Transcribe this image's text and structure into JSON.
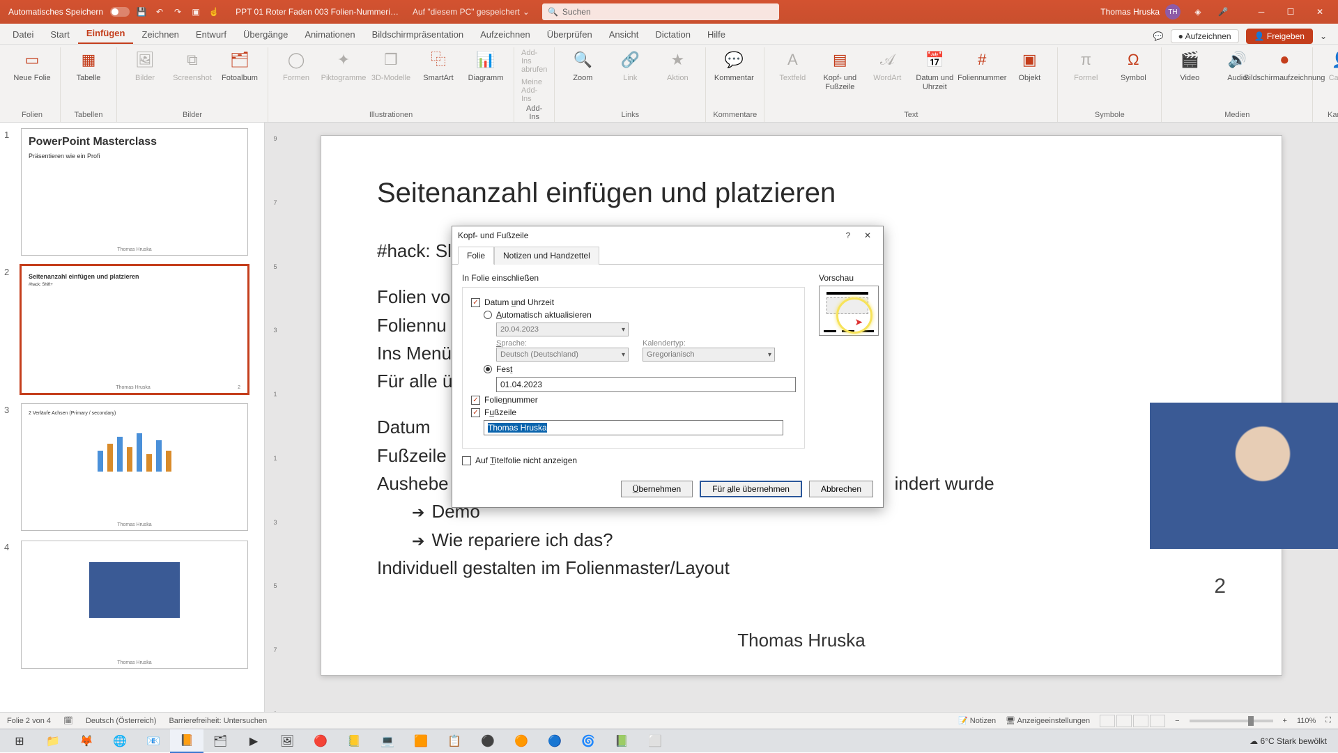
{
  "titlebar": {
    "autosave": "Automatisches Speichern",
    "filename": "PPT 01 Roter Faden 003 Folien-Nummeri…",
    "savedloc": "Auf \"diesem PC\" gespeichert",
    "search_placeholder": "Suchen",
    "user": "Thomas Hruska",
    "user_init": "TH"
  },
  "tabs": {
    "file": "Datei",
    "start": "Start",
    "insert": "Einfügen",
    "draw": "Zeichnen",
    "design": "Entwurf",
    "transitions": "Übergänge",
    "animations": "Animationen",
    "slideshow": "Bildschirmpräsentation",
    "record": "Aufzeichnen",
    "review": "Überprüfen",
    "view": "Ansicht",
    "dictation": "Dictation",
    "help": "Hilfe",
    "record_btn": "Aufzeichnen",
    "share_btn": "Freigeben"
  },
  "ribbon": {
    "new_slide": "Neue Folie",
    "table": "Tabelle",
    "pictures": "Bilder",
    "screenshot": "Screenshot",
    "album": "Fotoalbum",
    "shapes": "Formen",
    "icons": "Piktogramme",
    "models3d": "3D-Modelle",
    "smartart": "SmartArt",
    "chart": "Diagramm",
    "addins_get": "Add-Ins abrufen",
    "addins_my": "Meine Add-Ins",
    "zoom": "Zoom",
    "link": "Link",
    "action": "Aktion",
    "comment": "Kommentar",
    "textbox": "Textfeld",
    "header_footer": "Kopf- und Fußzeile",
    "wordart": "WordArt",
    "datetime": "Datum und Uhrzeit",
    "slidenum": "Foliennummer",
    "object": "Objekt",
    "equation": "Formel",
    "symbol": "Symbol",
    "video": "Video",
    "audio": "Audio",
    "screenrec": "Bildschirmaufzeichnung",
    "cameo": "Cameo",
    "group": {
      "slides": "Folien",
      "tables": "Tabellen",
      "images": "Bilder",
      "illustrations": "Illustrationen",
      "addins": "Add-Ins",
      "links": "Links",
      "comments": "Kommentare",
      "text": "Text",
      "symbols": "Symbole",
      "media": "Medien",
      "camera": "Kamera"
    }
  },
  "thumbs": {
    "t1": {
      "title": "PowerPoint Masterclass",
      "sub": "Präsentieren wie ein Profi",
      "footer": "Thomas Hruska"
    },
    "t2": {
      "title": "Seitenanzahl einfügen und platzieren",
      "line1": "#hack: Shift+",
      "pg": "2",
      "footer": "Thomas Hruska"
    },
    "t3": {
      "title": "2 Verläufe Achsen (Primary / secondary)",
      "footer": "Thomas Hruska"
    },
    "t4": {
      "footer": "Thomas Hruska"
    }
  },
  "slide": {
    "title": "Seitenanzahl einfügen und platzieren",
    "l1": "#hack: Sl",
    "l2": "Folien vo",
    "l3": "Foliennu",
    "l4": "Ins Menü",
    "l5": "Für alle ü",
    "l6": "Datum",
    "l7": "Fußzeile",
    "l8a": "Aushebe",
    "l8b": "indert wurde",
    "l9": "Demo",
    "l10": "Wie repariere ich das?",
    "l11": "Individuell gestalten im Folienmaster/Layout",
    "pgnum": "2",
    "footer_name": "Thomas Hruska"
  },
  "dialog": {
    "title": "Kopf- und Fußzeile",
    "tab1": "Folie",
    "tab2": "Notizen und Handzettel",
    "fieldset": "In Folie einschließen",
    "datetime": "Datum und Uhrzeit",
    "auto": "Automatisch aktualisieren",
    "auto_date": "20.04.2023",
    "lang_label": "Sprache:",
    "lang_val": "Deutsch (Deutschland)",
    "cal_label": "Kalendertyp:",
    "cal_val": "Gregorianisch",
    "fixed": "Fest",
    "fixed_val": "01.04.2023",
    "slidenum": "Foliennummer",
    "footer": "Fußzeile",
    "footer_val": "Thomas Hruska",
    "hide_title": "Auf Titelfolie nicht anzeigen",
    "preview": "Vorschau",
    "apply": "Übernehmen",
    "apply_all": "Für alle übernehmen",
    "cancel": "Abbrechen"
  },
  "statusbar": {
    "slide_count": "Folie 2 von 4",
    "lang": "Deutsch (Österreich)",
    "access": "Barrierefreiheit: Untersuchen",
    "notes": "Notizen",
    "display": "Anzeigeeinstellungen",
    "zoom": "110%"
  },
  "taskbar": {
    "weather": "6°C  Stark bewölkt"
  }
}
